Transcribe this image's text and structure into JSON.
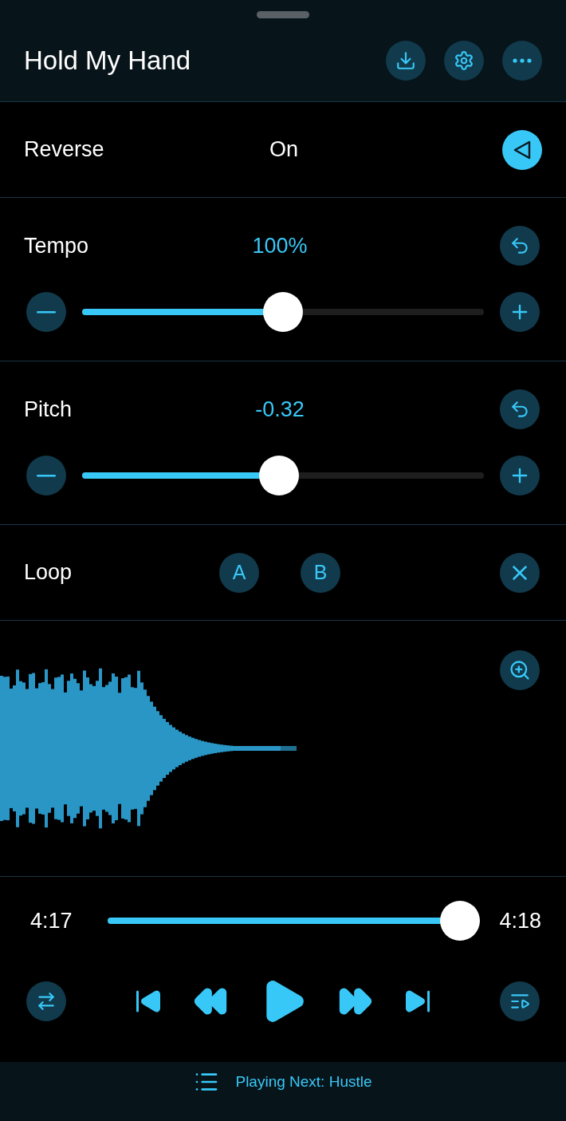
{
  "title": "Hold My Hand",
  "reverse": {
    "label": "Reverse",
    "value": "On",
    "on": true
  },
  "sliders": [
    {
      "label": "Tempo",
      "value": "100%",
      "level": 0.5
    },
    {
      "label": "Pitch",
      "value": "-0.32",
      "level": 0.49
    }
  ],
  "loop": {
    "label": "Loop",
    "points": [
      "A",
      "B"
    ]
  },
  "progress": {
    "elapsed": "4:17",
    "total": "4:18",
    "level": 0.98
  },
  "playing_next": "Playing Next: Hustle"
}
